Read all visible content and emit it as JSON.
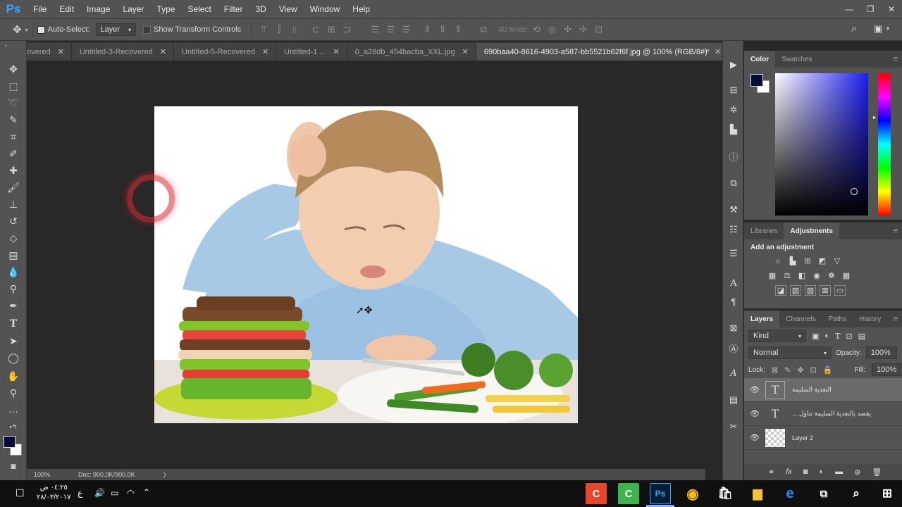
{
  "app": {
    "logo": "Ps",
    "window_controls": [
      "—",
      "❐",
      "✕"
    ]
  },
  "menu": [
    "File",
    "Edit",
    "Image",
    "Layer",
    "Type",
    "Select",
    "Filter",
    "3D",
    "View",
    "Window",
    "Help"
  ],
  "options_bar": {
    "auto_select_label": "Auto-Select:",
    "auto_select_target": "Layer",
    "show_transform_label": "Show Transform Controls",
    "mode_3d_label": "3D Mode:"
  },
  "tabs": [
    {
      "label": "overed",
      "active": false
    },
    {
      "label": "Untitled-3-Recovered",
      "active": false
    },
    {
      "label": "Untitled-5-Recovered",
      "active": false
    },
    {
      "label": "Untitled-1 ...",
      "active": false
    },
    {
      "label": "0_a28db_454bacba_XXL.jpg",
      "active": false
    },
    {
      "label": "690baa40-8616-4903-a587-bb5521b62f6f.jpg @ 100% (RGB/8#)",
      "active": true
    }
  ],
  "tab_close": "✕",
  "tabs_overflow": "»",
  "status": {
    "zoom": "100%",
    "doc": "Doc: 900.0K/900.0K",
    "arrow": "〉"
  },
  "color_panel": {
    "tabs": [
      "Color",
      "Swatches"
    ],
    "fg_color": "#0b0b3a",
    "hue_color": "#1e1ef0"
  },
  "adjustments_panel": {
    "tabs": [
      "Libraries",
      "Adjustments"
    ],
    "heading": "Add an adjustment"
  },
  "layers_panel": {
    "tabs": [
      "Layers",
      "Channels",
      "Paths",
      "History"
    ],
    "filter_label": "Kind",
    "blend_mode": "Normal",
    "opacity_label": "Opacity:",
    "opacity_value": "100%",
    "lock_label": "Lock:",
    "fill_label": "Fill:",
    "fill_value": "100%",
    "layers": [
      {
        "name": "التغذية السليمة",
        "type": "text",
        "selected": true
      },
      {
        "name": "... يقصد بالتغذية السليمة تناول",
        "type": "text",
        "selected": false
      },
      {
        "name": "Layer 2",
        "type": "pixel",
        "selected": false
      }
    ]
  },
  "taskbar": {
    "time": "٠٤:٢٥ ص",
    "date": "٢٨/٠٣/٢٠١٧",
    "lang": "ع"
  }
}
